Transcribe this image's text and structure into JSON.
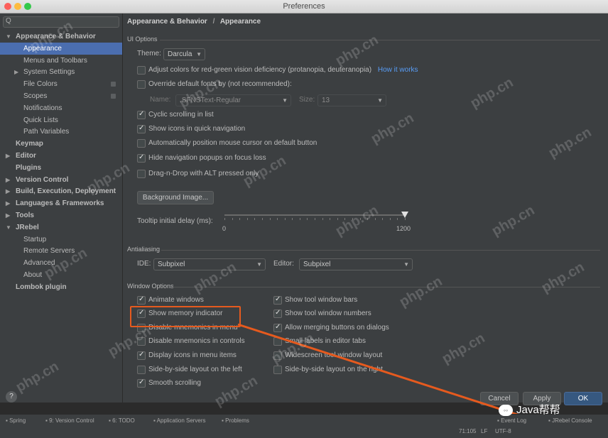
{
  "window": {
    "title": "Preferences"
  },
  "sidebar": {
    "search_placeholder": "Q",
    "items": [
      {
        "label": "Appearance & Behavior",
        "expanded": true
      },
      {
        "label": "Appearance",
        "selected": true
      },
      {
        "label": "Menus and Toolbars"
      },
      {
        "label": "System Settings"
      },
      {
        "label": "File Colors"
      },
      {
        "label": "Scopes"
      },
      {
        "label": "Notifications"
      },
      {
        "label": "Quick Lists"
      },
      {
        "label": "Path Variables"
      },
      {
        "label": "Keymap"
      },
      {
        "label": "Editor"
      },
      {
        "label": "Plugins"
      },
      {
        "label": "Version Control"
      },
      {
        "label": "Build, Execution, Deployment"
      },
      {
        "label": "Languages & Frameworks"
      },
      {
        "label": "Tools"
      },
      {
        "label": "JRebel"
      },
      {
        "label": "Startup"
      },
      {
        "label": "Remote Servers"
      },
      {
        "label": "Advanced"
      },
      {
        "label": "About"
      },
      {
        "label": "Lombok plugin"
      }
    ]
  },
  "breadcrumb": {
    "parent": "Appearance & Behavior",
    "separator": "/",
    "current": "Appearance"
  },
  "ui_options": {
    "header": "UI Options",
    "theme_label": "Theme:",
    "theme_value": "Darcula",
    "adjust_colors": {
      "label": "Adjust colors for red-green vision deficiency (protanopia, deuteranopia)",
      "checked": false,
      "link": "How it works"
    },
    "override_fonts": {
      "label": "Override default fonts by (not recommended):",
      "checked": false
    },
    "font_name_label": "Name:",
    "font_name_value": ".SFNSText-Regular",
    "font_size_label": "Size:",
    "font_size_value": "13",
    "checks": [
      {
        "label": "Cyclic scrolling in list",
        "checked": true
      },
      {
        "label": "Show icons in quick navigation",
        "checked": true
      },
      {
        "label": "Automatically position mouse cursor on default button",
        "checked": false
      },
      {
        "label": "Hide navigation popups on focus loss",
        "checked": true
      },
      {
        "label": "Drag-n-Drop with ALT pressed only",
        "checked": false
      }
    ],
    "background_image_button": "Background Image...",
    "tooltip_label": "Tooltip initial delay (ms):",
    "tooltip_min": "0",
    "tooltip_max": "1200",
    "tooltip_value_fraction": 1.0
  },
  "antialiasing": {
    "header": "Antialiasing",
    "ide_label": "IDE:",
    "ide_value": "Subpixel",
    "editor_label": "Editor:",
    "editor_value": "Subpixel"
  },
  "window_options": {
    "header": "Window Options",
    "left": [
      {
        "label": "Animate windows",
        "checked": true
      },
      {
        "label": "Show memory indicator",
        "checked": true
      },
      {
        "label": "Disable mnemonics in menu",
        "checked": false
      },
      {
        "label": "Disable mnemonics in controls",
        "checked": false
      },
      {
        "label": "Display icons in menu items",
        "checked": true
      },
      {
        "label": "Side-by-side layout on the left",
        "checked": false
      },
      {
        "label": "Smooth scrolling",
        "checked": true
      }
    ],
    "right": [
      {
        "label": "Show tool window bars",
        "checked": true
      },
      {
        "label": "Show tool window numbers",
        "checked": true
      },
      {
        "label": "Allow merging buttons on dialogs",
        "checked": true
      },
      {
        "label": "Small labels in editor tabs",
        "checked": false
      },
      {
        "label": "Widescreen tool window layout",
        "checked": false
      },
      {
        "label": "Side-by-side layout on the right",
        "checked": false
      }
    ]
  },
  "dialog_buttons": {
    "help": "?",
    "cancel": "Cancel",
    "apply": "Apply",
    "ok": "OK"
  },
  "tool_windows": [
    "Spring",
    "9: Version Control",
    "6: TODO",
    "Application Servers",
    "Problems",
    "Event Log",
    "JRebel Console"
  ],
  "status": {
    "position": "71:105",
    "line_sep": "LF",
    "encoding": "UTF-8"
  },
  "watermark": "php.cn",
  "brand": "Java帮帮",
  "colors": {
    "accent": "#4b6eaf",
    "highlight": "#e65a1e",
    "ok_button": "#365880"
  }
}
